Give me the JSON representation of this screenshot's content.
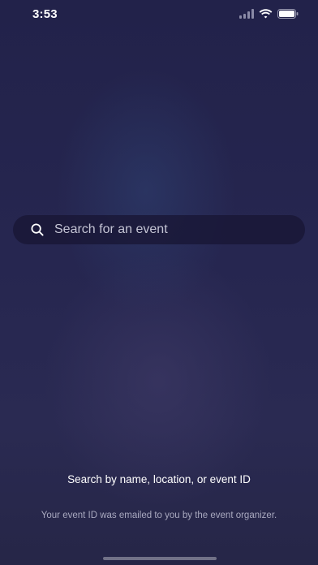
{
  "status_bar": {
    "time": "3:53",
    "icons": [
      "cellular-signal-icon",
      "wifi-icon",
      "battery-icon"
    ]
  },
  "search": {
    "placeholder": "Search for an event",
    "value": "",
    "icon": "search-icon"
  },
  "help": {
    "title": "Search by name, location, or event ID",
    "subtitle": "Your event ID was emailed to you by the event organizer."
  },
  "colors": {
    "background": "#242449",
    "search_bar": "#1a1836",
    "text_primary": "#ffffff",
    "text_secondary": "#a9a9bf"
  }
}
